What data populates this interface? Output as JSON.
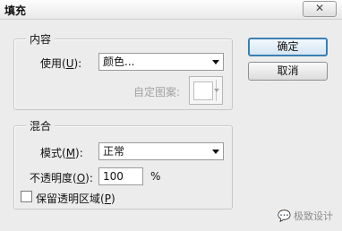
{
  "window": {
    "title": "填充",
    "close_label": "✕"
  },
  "content_group": {
    "title": "内容",
    "use_label_main": "使用(",
    "use_label_key": "U",
    "use_label_end": "):",
    "use_value": "颜色...",
    "pattern_label": "自定图案:"
  },
  "blend_group": {
    "title": "混合",
    "mode_label_main": "模式(",
    "mode_label_key": "M",
    "mode_label_end": "):",
    "mode_value": "正常",
    "opacity_label_main": "不透明度(",
    "opacity_label_key": "O",
    "opacity_label_end": "):",
    "opacity_value": "100",
    "opacity_unit": "%",
    "preserve_label_main": "保留透明区域(",
    "preserve_label_key": "P",
    "preserve_label_end": ")",
    "preserve_checked": false
  },
  "buttons": {
    "ok": "确定",
    "cancel": "取消"
  },
  "watermark": {
    "icon": "chat-bubble-icon",
    "text": "极致设计"
  }
}
